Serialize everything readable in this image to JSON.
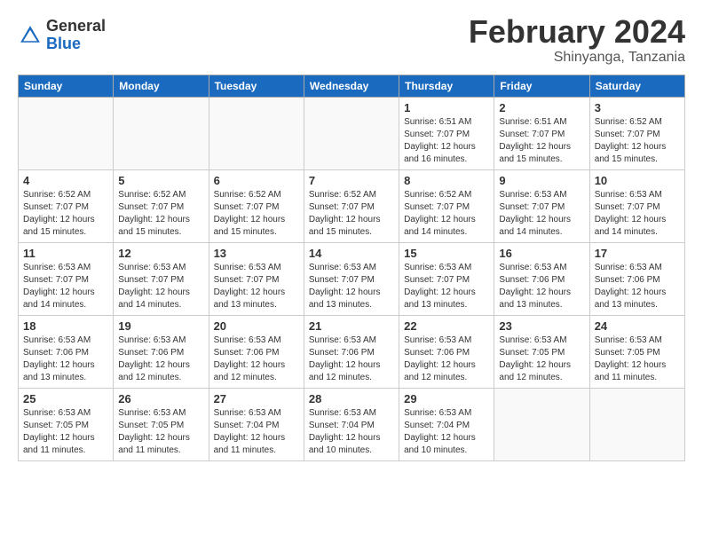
{
  "logo": {
    "general": "General",
    "blue": "Blue"
  },
  "title": "February 2024",
  "subtitle": "Shinyanga, Tanzania",
  "days_of_week": [
    "Sunday",
    "Monday",
    "Tuesday",
    "Wednesday",
    "Thursday",
    "Friday",
    "Saturday"
  ],
  "weeks": [
    [
      {
        "day": "",
        "info": ""
      },
      {
        "day": "",
        "info": ""
      },
      {
        "day": "",
        "info": ""
      },
      {
        "day": "",
        "info": ""
      },
      {
        "day": "1",
        "info": "Sunrise: 6:51 AM\nSunset: 7:07 PM\nDaylight: 12 hours\nand 16 minutes."
      },
      {
        "day": "2",
        "info": "Sunrise: 6:51 AM\nSunset: 7:07 PM\nDaylight: 12 hours\nand 15 minutes."
      },
      {
        "day": "3",
        "info": "Sunrise: 6:52 AM\nSunset: 7:07 PM\nDaylight: 12 hours\nand 15 minutes."
      }
    ],
    [
      {
        "day": "4",
        "info": "Sunrise: 6:52 AM\nSunset: 7:07 PM\nDaylight: 12 hours\nand 15 minutes."
      },
      {
        "day": "5",
        "info": "Sunrise: 6:52 AM\nSunset: 7:07 PM\nDaylight: 12 hours\nand 15 minutes."
      },
      {
        "day": "6",
        "info": "Sunrise: 6:52 AM\nSunset: 7:07 PM\nDaylight: 12 hours\nand 15 minutes."
      },
      {
        "day": "7",
        "info": "Sunrise: 6:52 AM\nSunset: 7:07 PM\nDaylight: 12 hours\nand 15 minutes."
      },
      {
        "day": "8",
        "info": "Sunrise: 6:52 AM\nSunset: 7:07 PM\nDaylight: 12 hours\nand 14 minutes."
      },
      {
        "day": "9",
        "info": "Sunrise: 6:53 AM\nSunset: 7:07 PM\nDaylight: 12 hours\nand 14 minutes."
      },
      {
        "day": "10",
        "info": "Sunrise: 6:53 AM\nSunset: 7:07 PM\nDaylight: 12 hours\nand 14 minutes."
      }
    ],
    [
      {
        "day": "11",
        "info": "Sunrise: 6:53 AM\nSunset: 7:07 PM\nDaylight: 12 hours\nand 14 minutes."
      },
      {
        "day": "12",
        "info": "Sunrise: 6:53 AM\nSunset: 7:07 PM\nDaylight: 12 hours\nand 14 minutes."
      },
      {
        "day": "13",
        "info": "Sunrise: 6:53 AM\nSunset: 7:07 PM\nDaylight: 12 hours\nand 13 minutes."
      },
      {
        "day": "14",
        "info": "Sunrise: 6:53 AM\nSunset: 7:07 PM\nDaylight: 12 hours\nand 13 minutes."
      },
      {
        "day": "15",
        "info": "Sunrise: 6:53 AM\nSunset: 7:07 PM\nDaylight: 12 hours\nand 13 minutes."
      },
      {
        "day": "16",
        "info": "Sunrise: 6:53 AM\nSunset: 7:06 PM\nDaylight: 12 hours\nand 13 minutes."
      },
      {
        "day": "17",
        "info": "Sunrise: 6:53 AM\nSunset: 7:06 PM\nDaylight: 12 hours\nand 13 minutes."
      }
    ],
    [
      {
        "day": "18",
        "info": "Sunrise: 6:53 AM\nSunset: 7:06 PM\nDaylight: 12 hours\nand 13 minutes."
      },
      {
        "day": "19",
        "info": "Sunrise: 6:53 AM\nSunset: 7:06 PM\nDaylight: 12 hours\nand 12 minutes."
      },
      {
        "day": "20",
        "info": "Sunrise: 6:53 AM\nSunset: 7:06 PM\nDaylight: 12 hours\nand 12 minutes."
      },
      {
        "day": "21",
        "info": "Sunrise: 6:53 AM\nSunset: 7:06 PM\nDaylight: 12 hours\nand 12 minutes."
      },
      {
        "day": "22",
        "info": "Sunrise: 6:53 AM\nSunset: 7:06 PM\nDaylight: 12 hours\nand 12 minutes."
      },
      {
        "day": "23",
        "info": "Sunrise: 6:53 AM\nSunset: 7:05 PM\nDaylight: 12 hours\nand 12 minutes."
      },
      {
        "day": "24",
        "info": "Sunrise: 6:53 AM\nSunset: 7:05 PM\nDaylight: 12 hours\nand 11 minutes."
      }
    ],
    [
      {
        "day": "25",
        "info": "Sunrise: 6:53 AM\nSunset: 7:05 PM\nDaylight: 12 hours\nand 11 minutes."
      },
      {
        "day": "26",
        "info": "Sunrise: 6:53 AM\nSunset: 7:05 PM\nDaylight: 12 hours\nand 11 minutes."
      },
      {
        "day": "27",
        "info": "Sunrise: 6:53 AM\nSunset: 7:04 PM\nDaylight: 12 hours\nand 11 minutes."
      },
      {
        "day": "28",
        "info": "Sunrise: 6:53 AM\nSunset: 7:04 PM\nDaylight: 12 hours\nand 10 minutes."
      },
      {
        "day": "29",
        "info": "Sunrise: 6:53 AM\nSunset: 7:04 PM\nDaylight: 12 hours\nand 10 minutes."
      },
      {
        "day": "",
        "info": ""
      },
      {
        "day": "",
        "info": ""
      }
    ]
  ]
}
